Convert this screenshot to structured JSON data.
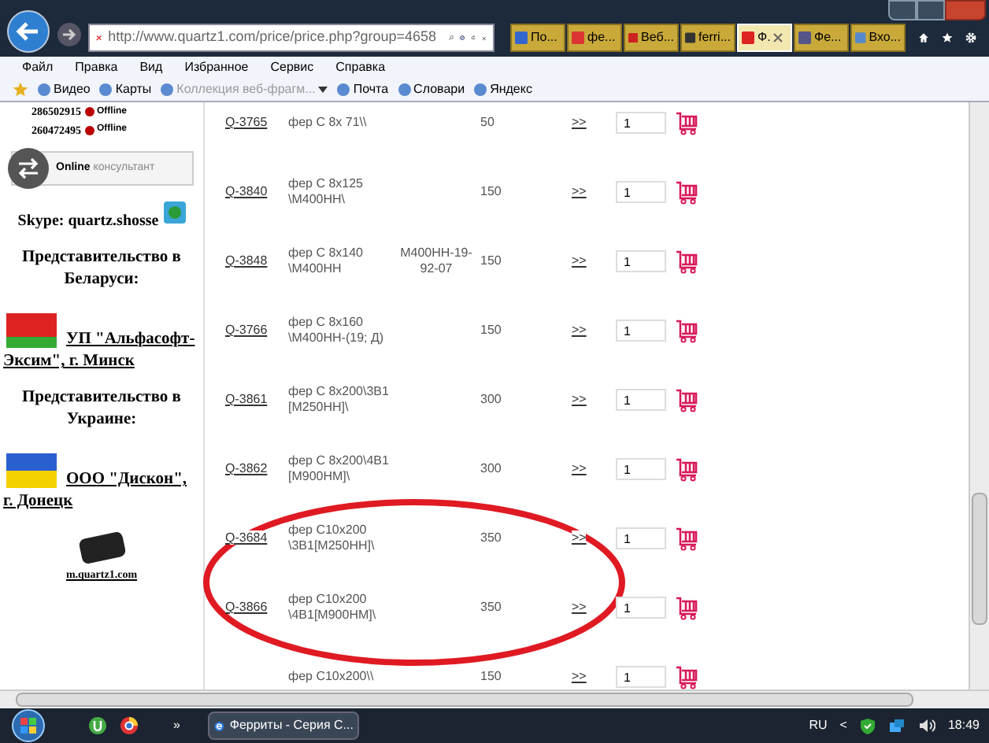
{
  "browser": {
    "address": "http://www.quartz1.com/price/price.php?group=4658",
    "tabs": [
      {
        "label": "По...",
        "selected": false
      },
      {
        "label": "фе...",
        "selected": false
      },
      {
        "label": "Веб...",
        "selected": false
      },
      {
        "label": "ferri...",
        "selected": false
      },
      {
        "label": "Ф.",
        "selected": true
      },
      {
        "label": "Фе...",
        "selected": false
      },
      {
        "label": "Вхо...",
        "selected": false
      }
    ],
    "menu": [
      "Файл",
      "Правка",
      "Вид",
      "Избранное",
      "Сервис",
      "Справка"
    ],
    "favorites": [
      {
        "label": "Видео",
        "disabled": false
      },
      {
        "label": "Карты",
        "disabled": false
      },
      {
        "label": "Коллекция веб-фрагм...",
        "disabled": true
      },
      {
        "label": "Почта",
        "disabled": false
      },
      {
        "label": "Словари",
        "disabled": false
      },
      {
        "label": "Яндекс",
        "disabled": false
      }
    ]
  },
  "sidebar": {
    "contacts": [
      {
        "number": "286502915",
        "status": "Offline",
        "online": false
      },
      {
        "number": "260472495",
        "status": "Offline",
        "online": false
      }
    ],
    "consultant": {
      "bold": "Online",
      "rest": "консультант"
    },
    "skype": "Skype: quartz.shosse",
    "offices": [
      {
        "heading": "Представительство в Беларуси:",
        "company": "УП \"Альфасофт-Эксим\", г. Минск"
      },
      {
        "heading": "Представительство в Украине:",
        "company": "ООО \"Дискон\", г. Донецк"
      }
    ],
    "mobile_link": "m.quartz1.com"
  },
  "table": {
    "rows": [
      {
        "code": "Q-3765",
        "name": "фер С 8х 71\\\\",
        "column_3": "",
        "price": "50",
        "more": ">>",
        "qty": "1"
      },
      {
        "code": "Q-3840",
        "name": "фер С 8х125 \\М400НН\\",
        "column_3": "",
        "price": "150",
        "more": ">>",
        "qty": "1"
      },
      {
        "code": "Q-3848",
        "name": "фер С 8х140 \\М400НН",
        "column_3": "М400НН-19-92-07",
        "price": "150",
        "more": ">>",
        "qty": "1"
      },
      {
        "code": "Q-3766",
        "name": "фер С 8х160 \\М400НН-(19; Д)",
        "column_3": "",
        "price": "150",
        "more": ">>",
        "qty": "1"
      },
      {
        "code": "Q-3861",
        "name": "фер С 8х200\\3В1 [М250НН]\\",
        "column_3": "",
        "price": "300",
        "more": ">>",
        "qty": "1"
      },
      {
        "code": "Q-3862",
        "name": "фер С 8х200\\4В1 [М900НМ]\\",
        "column_3": "",
        "price": "300",
        "more": ">>",
        "qty": "1"
      },
      {
        "code": "Q-3684",
        "name": "фер С10х200 \\3В1[М250НН]\\",
        "column_3": "",
        "price": "350",
        "more": ">>",
        "qty": "1"
      },
      {
        "code": "Q-3866",
        "name": "фер С10х200 \\4В1[М900НМ]\\",
        "column_3": "",
        "price": "350",
        "more": ">>",
        "qty": "1"
      },
      {
        "code": "",
        "name": "фер С10х200\\\\",
        "column_3": "",
        "price": "150",
        "more": ">>",
        "qty": "1"
      }
    ]
  },
  "taskbar": {
    "task": "Ферриты - Серия С...",
    "overflow": "»",
    "language": "RU",
    "tray_arrow": "<",
    "time": "18:49"
  }
}
